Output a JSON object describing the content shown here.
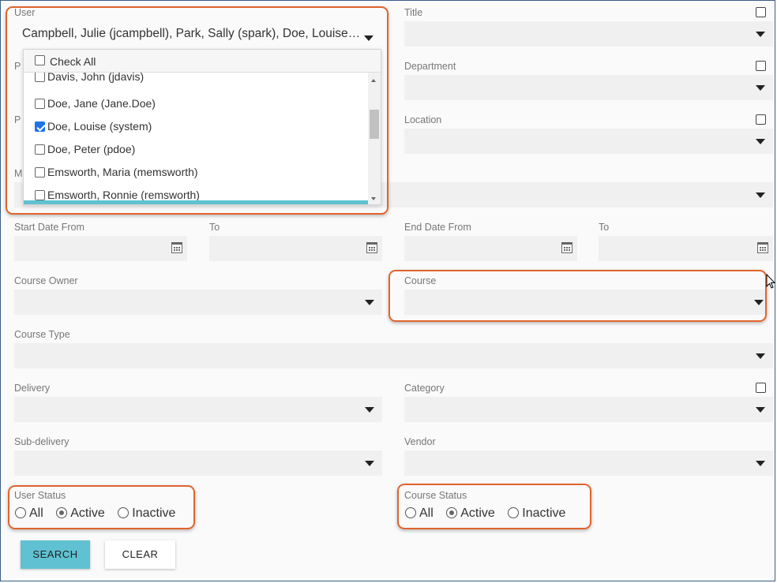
{
  "fields": {
    "user": {
      "label": "User",
      "value": "Campbell, Julie (jcampbell), Park, Sally (spark), Doe, Louise (system)"
    },
    "title": {
      "label": "Title"
    },
    "department": {
      "label": "Department"
    },
    "location": {
      "label": "Location"
    },
    "p1_partial": "P",
    "p2_partial": "P",
    "m_partial": "M",
    "start_date_from": {
      "label": "Start Date From"
    },
    "start_to": {
      "label": "To"
    },
    "end_date_from": {
      "label": "End Date From"
    },
    "end_to": {
      "label": "To"
    },
    "course_owner": {
      "label": "Course Owner"
    },
    "course": {
      "label": "Course"
    },
    "course_type": {
      "label": "Course Type"
    },
    "delivery": {
      "label": "Delivery"
    },
    "category": {
      "label": "Category"
    },
    "sub_delivery": {
      "label": "Sub-delivery"
    },
    "vendor": {
      "label": "Vendor"
    }
  },
  "user_dropdown": {
    "check_all": "Check All",
    "items": [
      {
        "label": "Davis, John (jdavis)",
        "checked": false
      },
      {
        "label": "Doe, Jane (Jane.Doe)",
        "checked": false
      },
      {
        "label": "Doe, Louise (system)",
        "checked": true
      },
      {
        "label": "Doe, Peter (pdoe)",
        "checked": false
      },
      {
        "label": "Emsworth, Maria (memsworth)",
        "checked": false
      },
      {
        "label": "Emsworth, Ronnie (remsworth)",
        "checked": false
      }
    ]
  },
  "user_status": {
    "label": "User Status",
    "options": [
      "All",
      "Active",
      "Inactive"
    ],
    "selected": "Active"
  },
  "course_status": {
    "label": "Course Status",
    "options": [
      "All",
      "Active",
      "Inactive"
    ],
    "selected": "Active"
  },
  "buttons": {
    "search": "SEARCH",
    "clear": "CLEAR"
  },
  "colors": {
    "accent": "#5fc1d1",
    "highlight": "#e0642d",
    "field_bg": "#f0f0f0"
  }
}
